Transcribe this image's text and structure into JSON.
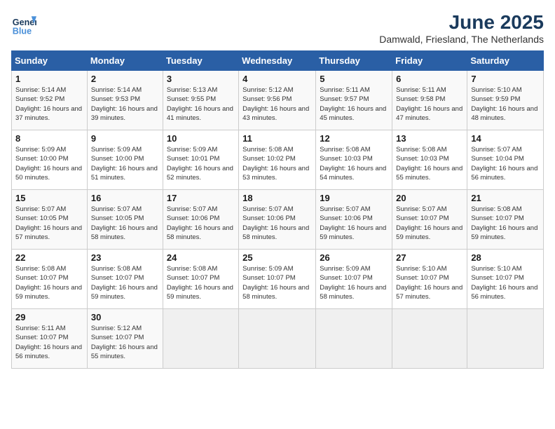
{
  "logo": {
    "line1": "General",
    "line2": "Blue"
  },
  "title": "June 2025",
  "subtitle": "Damwald, Friesland, The Netherlands",
  "days_header": [
    "Sunday",
    "Monday",
    "Tuesday",
    "Wednesday",
    "Thursday",
    "Friday",
    "Saturday"
  ],
  "weeks": [
    [
      {
        "day": "1",
        "sunrise": "5:14 AM",
        "sunset": "9:52 PM",
        "daylight": "16 hours and 37 minutes."
      },
      {
        "day": "2",
        "sunrise": "5:14 AM",
        "sunset": "9:53 PM",
        "daylight": "16 hours and 39 minutes."
      },
      {
        "day": "3",
        "sunrise": "5:13 AM",
        "sunset": "9:55 PM",
        "daylight": "16 hours and 41 minutes."
      },
      {
        "day": "4",
        "sunrise": "5:12 AM",
        "sunset": "9:56 PM",
        "daylight": "16 hours and 43 minutes."
      },
      {
        "day": "5",
        "sunrise": "5:11 AM",
        "sunset": "9:57 PM",
        "daylight": "16 hours and 45 minutes."
      },
      {
        "day": "6",
        "sunrise": "5:11 AM",
        "sunset": "9:58 PM",
        "daylight": "16 hours and 47 minutes."
      },
      {
        "day": "7",
        "sunrise": "5:10 AM",
        "sunset": "9:59 PM",
        "daylight": "16 hours and 48 minutes."
      }
    ],
    [
      {
        "day": "8",
        "sunrise": "5:09 AM",
        "sunset": "10:00 PM",
        "daylight": "16 hours and 50 minutes."
      },
      {
        "day": "9",
        "sunrise": "5:09 AM",
        "sunset": "10:00 PM",
        "daylight": "16 hours and 51 minutes."
      },
      {
        "day": "10",
        "sunrise": "5:09 AM",
        "sunset": "10:01 PM",
        "daylight": "16 hours and 52 minutes."
      },
      {
        "day": "11",
        "sunrise": "5:08 AM",
        "sunset": "10:02 PM",
        "daylight": "16 hours and 53 minutes."
      },
      {
        "day": "12",
        "sunrise": "5:08 AM",
        "sunset": "10:03 PM",
        "daylight": "16 hours and 54 minutes."
      },
      {
        "day": "13",
        "sunrise": "5:08 AM",
        "sunset": "10:03 PM",
        "daylight": "16 hours and 55 minutes."
      },
      {
        "day": "14",
        "sunrise": "5:07 AM",
        "sunset": "10:04 PM",
        "daylight": "16 hours and 56 minutes."
      }
    ],
    [
      {
        "day": "15",
        "sunrise": "5:07 AM",
        "sunset": "10:05 PM",
        "daylight": "16 hours and 57 minutes."
      },
      {
        "day": "16",
        "sunrise": "5:07 AM",
        "sunset": "10:05 PM",
        "daylight": "16 hours and 58 minutes."
      },
      {
        "day": "17",
        "sunrise": "5:07 AM",
        "sunset": "10:06 PM",
        "daylight": "16 hours and 58 minutes."
      },
      {
        "day": "18",
        "sunrise": "5:07 AM",
        "sunset": "10:06 PM",
        "daylight": "16 hours and 58 minutes."
      },
      {
        "day": "19",
        "sunrise": "5:07 AM",
        "sunset": "10:06 PM",
        "daylight": "16 hours and 59 minutes."
      },
      {
        "day": "20",
        "sunrise": "5:07 AM",
        "sunset": "10:07 PM",
        "daylight": "16 hours and 59 minutes."
      },
      {
        "day": "21",
        "sunrise": "5:08 AM",
        "sunset": "10:07 PM",
        "daylight": "16 hours and 59 minutes."
      }
    ],
    [
      {
        "day": "22",
        "sunrise": "5:08 AM",
        "sunset": "10:07 PM",
        "daylight": "16 hours and 59 minutes."
      },
      {
        "day": "23",
        "sunrise": "5:08 AM",
        "sunset": "10:07 PM",
        "daylight": "16 hours and 59 minutes."
      },
      {
        "day": "24",
        "sunrise": "5:08 AM",
        "sunset": "10:07 PM",
        "daylight": "16 hours and 59 minutes."
      },
      {
        "day": "25",
        "sunrise": "5:09 AM",
        "sunset": "10:07 PM",
        "daylight": "16 hours and 58 minutes."
      },
      {
        "day": "26",
        "sunrise": "5:09 AM",
        "sunset": "10:07 PM",
        "daylight": "16 hours and 58 minutes."
      },
      {
        "day": "27",
        "sunrise": "5:10 AM",
        "sunset": "10:07 PM",
        "daylight": "16 hours and 57 minutes."
      },
      {
        "day": "28",
        "sunrise": "5:10 AM",
        "sunset": "10:07 PM",
        "daylight": "16 hours and 56 minutes."
      }
    ],
    [
      {
        "day": "29",
        "sunrise": "5:11 AM",
        "sunset": "10:07 PM",
        "daylight": "16 hours and 56 minutes."
      },
      {
        "day": "30",
        "sunrise": "5:12 AM",
        "sunset": "10:07 PM",
        "daylight": "16 hours and 55 minutes."
      },
      null,
      null,
      null,
      null,
      null
    ]
  ]
}
